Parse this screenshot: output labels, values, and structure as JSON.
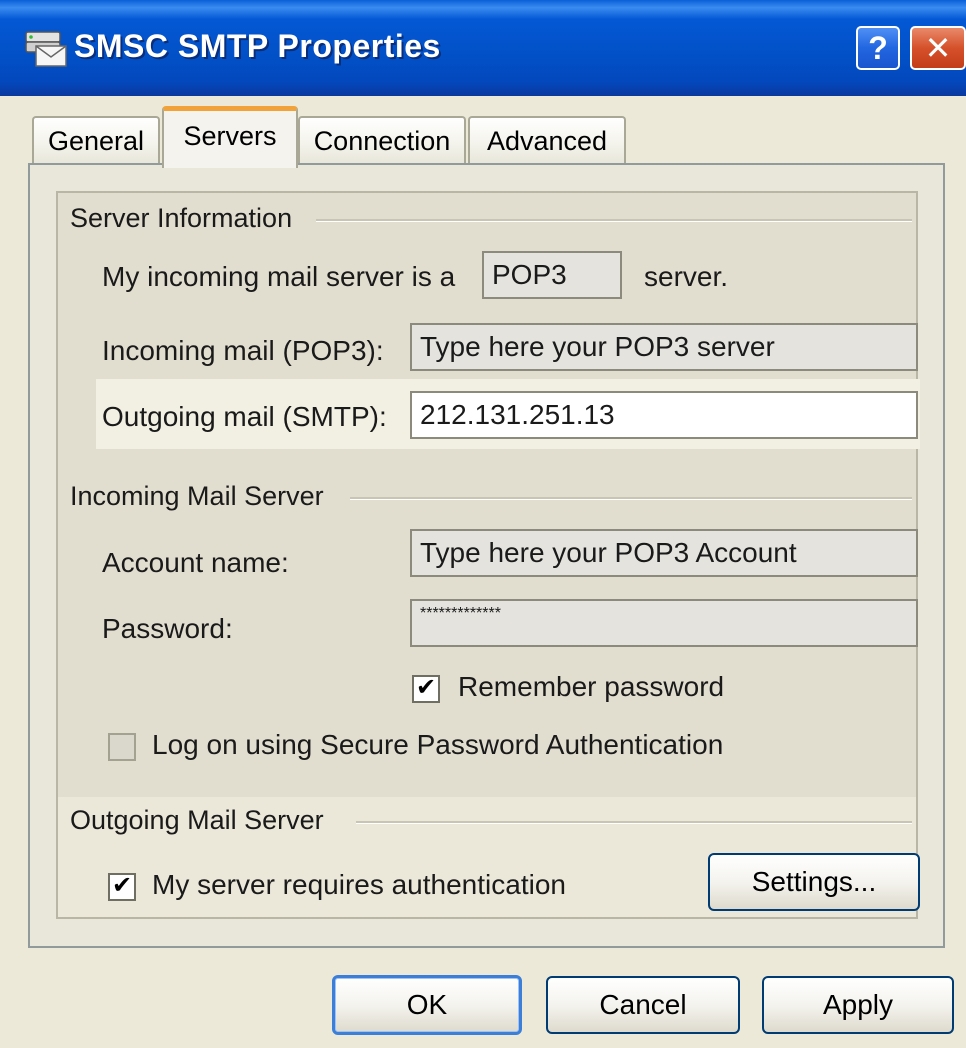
{
  "window": {
    "title": "SMSC SMTP Properties",
    "help_glyph": "?",
    "close_glyph": "✕"
  },
  "tabs": [
    {
      "label": "General",
      "active": false
    },
    {
      "label": "Servers",
      "active": true
    },
    {
      "label": "Connection",
      "active": false
    },
    {
      "label": "Advanced",
      "active": false
    }
  ],
  "server_info": {
    "group_label": "Server Information",
    "incoming_type_prefix": "My incoming mail server is a",
    "incoming_type_value": "POP3",
    "incoming_type_suffix": "server.",
    "incoming_label": "Incoming mail (POP3):",
    "incoming_value": "Type here your POP3 server",
    "outgoing_label": "Outgoing mail (SMTP):",
    "outgoing_value": "212.131.251.13"
  },
  "incoming_mail_server": {
    "group_label": "Incoming Mail Server",
    "account_label": "Account name:",
    "account_value": "Type here your POP3 Account",
    "password_label": "Password:",
    "password_value": "*************",
    "remember_label": "Remember password",
    "remember_checked": true,
    "spa_label": "Log on using Secure Password Authentication",
    "spa_checked": false
  },
  "outgoing_mail_server": {
    "group_label": "Outgoing Mail Server",
    "auth_label": "My server requires authentication",
    "auth_checked": true,
    "settings_button": "Settings..."
  },
  "buttons": {
    "ok": "OK",
    "cancel": "Cancel",
    "apply": "Apply"
  },
  "check_glyph": "✔",
  "colors": {
    "titlebar": "#0251c8",
    "active_tab_accent": "#f1a33a",
    "dialog_bg": "#ece9d8",
    "close_button": "#d5512b"
  },
  "icons": {
    "title": "mail-server-icon",
    "help": "help-icon",
    "close": "close-icon"
  }
}
